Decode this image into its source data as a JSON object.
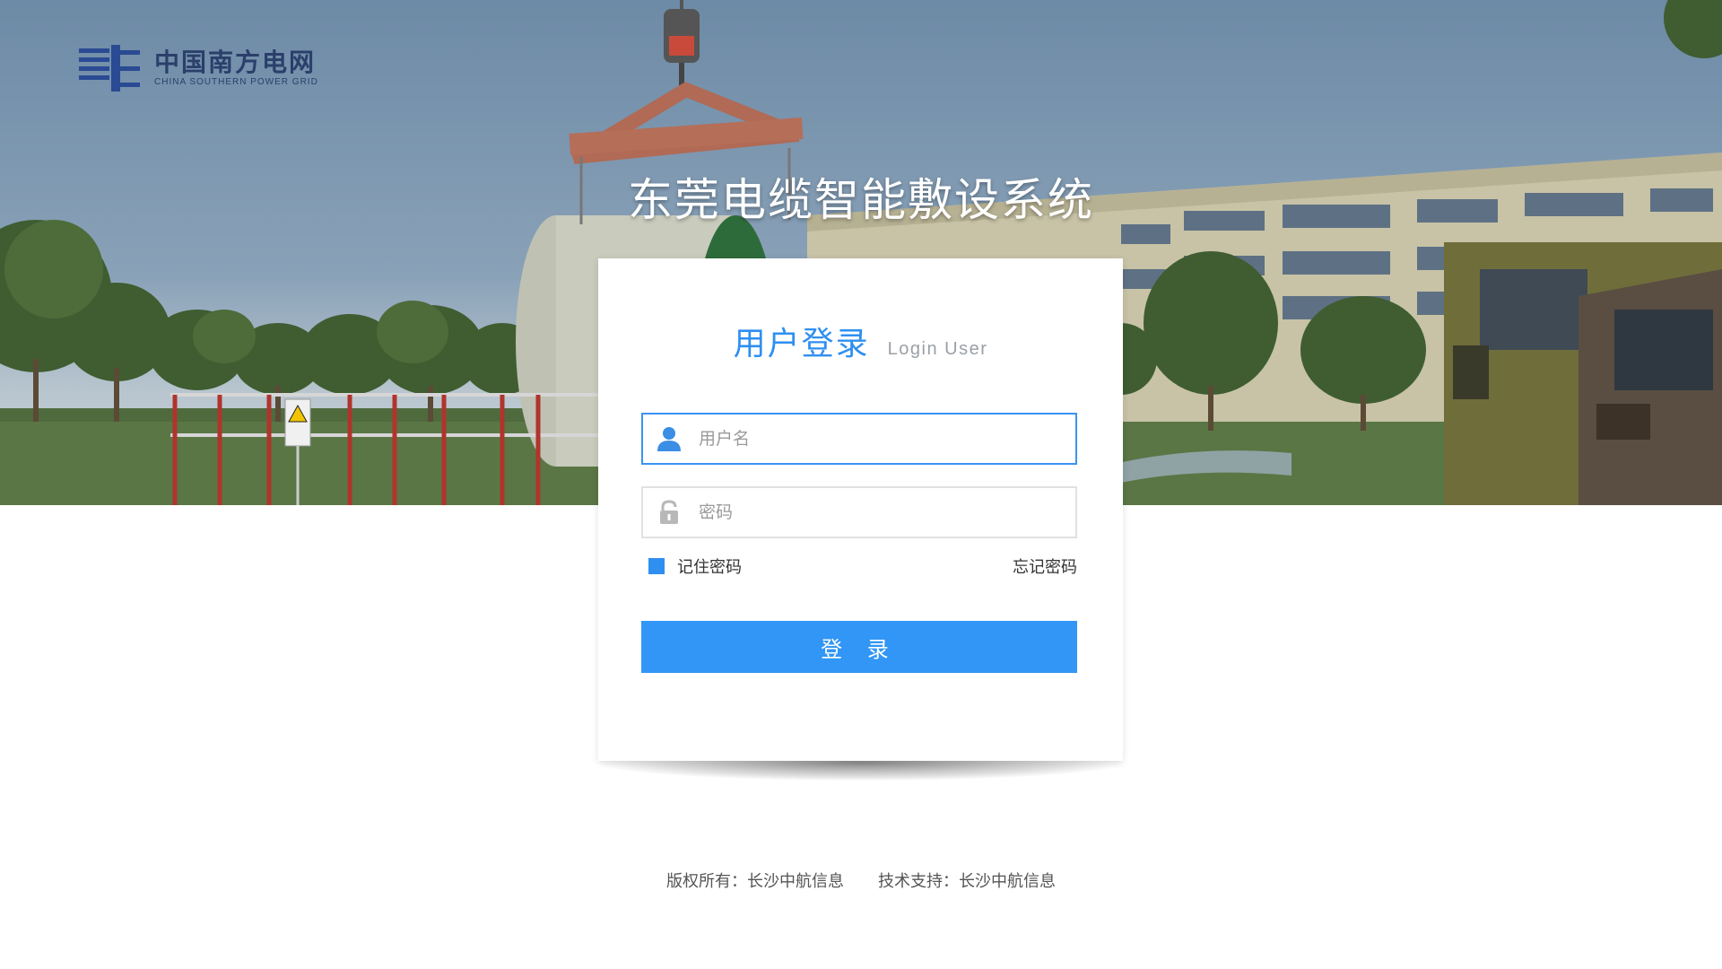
{
  "brand": {
    "logo_cn": "中国南方电网",
    "logo_en": "CHINA SOUTHERN POWER GRID",
    "color": "#2b3f6b"
  },
  "system_title": "东莞电缆智能敷设系统",
  "login": {
    "heading_cn": "用户登录",
    "heading_en": "Login User",
    "username": {
      "placeholder": "用户名",
      "value": "",
      "icon": "user-icon"
    },
    "password": {
      "placeholder": "密码",
      "value": "",
      "icon": "lock-icon"
    },
    "remember_label": "记住密码",
    "remember_checked": true,
    "forgot_label": "忘记密码",
    "submit_label": "登 录"
  },
  "footer": {
    "copyright": "版权所有：长沙中航信息",
    "support": "技术支持：长沙中航信息"
  },
  "colors": {
    "accent": "#3196f5",
    "heading": "#2f8ff0",
    "text": "#333333",
    "muted": "#9aa0a6"
  }
}
